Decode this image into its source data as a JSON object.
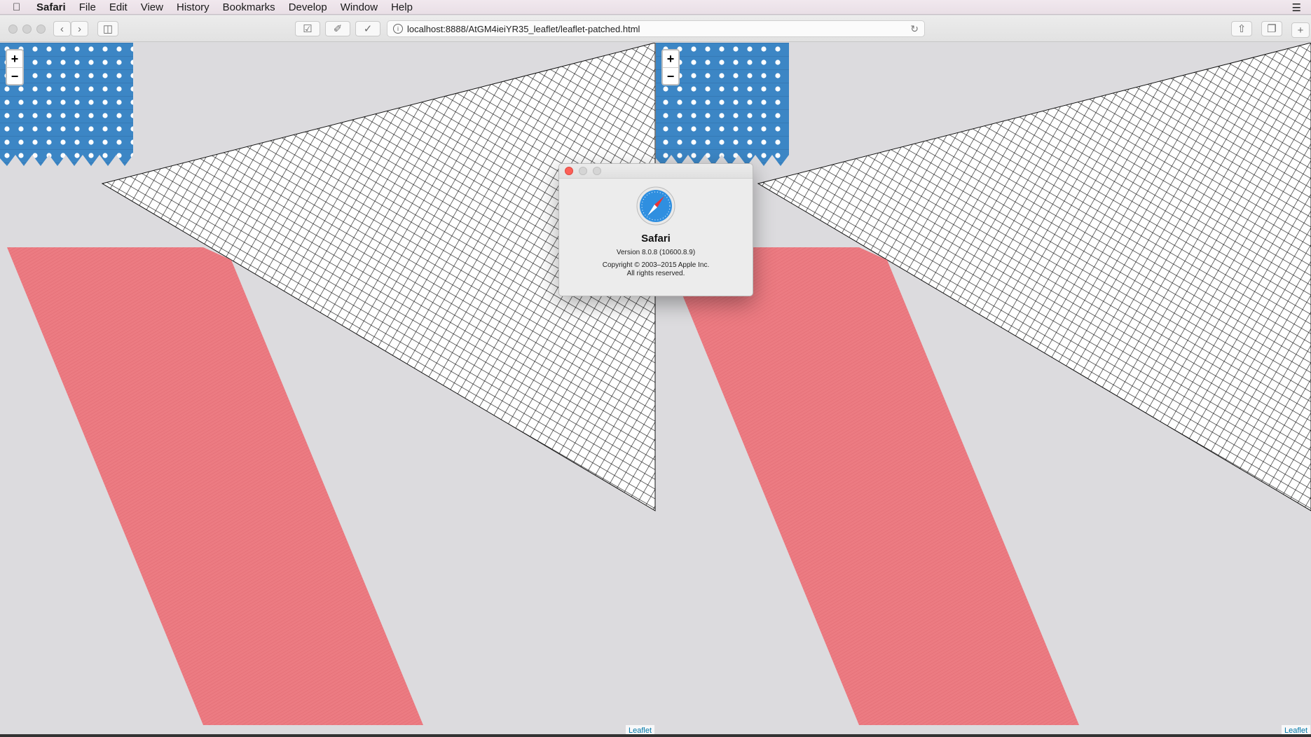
{
  "menubar": {
    "app_name": "Safari",
    "items": [
      "File",
      "Edit",
      "View",
      "History",
      "Bookmarks",
      "Develop",
      "Window",
      "Help"
    ]
  },
  "toolbar": {
    "url": "localhost:8888/AtGM4ieiYR35_leaflet/leaflet-patched.html"
  },
  "map": {
    "zoom_in": "+",
    "zoom_out": "−",
    "attribution": "Leaflet"
  },
  "about_dialog": {
    "app_name": "Safari",
    "version": "Version 8.0.8 (10600.8.9)",
    "copyright": "Copyright © 2003–2015 Apple Inc.",
    "rights": "All rights reserved."
  },
  "colors": {
    "marker_blue": "#3c86c5",
    "polygon_red": "#ec7b82",
    "map_bg": "#dcdbde"
  }
}
